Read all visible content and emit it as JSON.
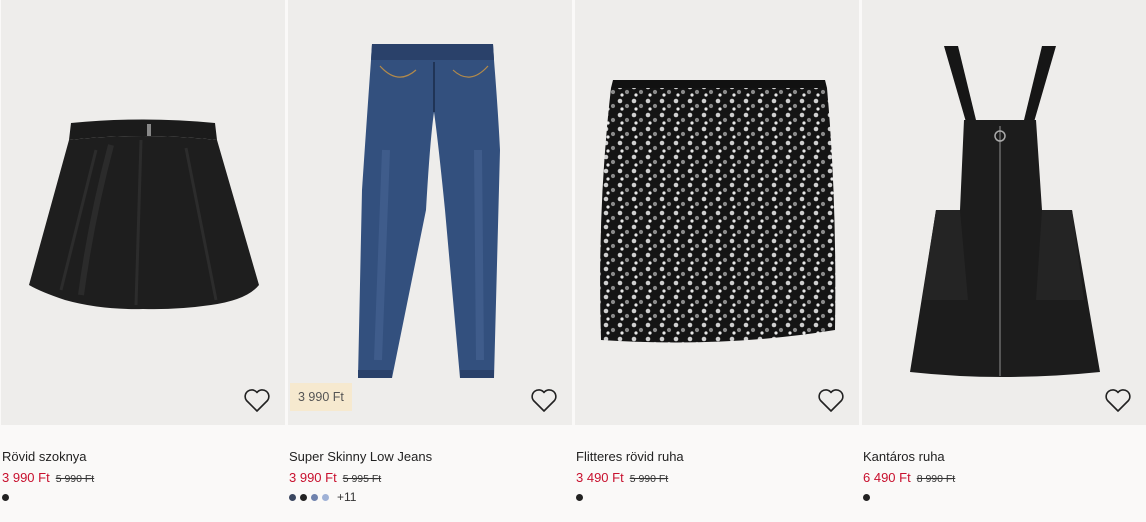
{
  "products": [
    {
      "name": "Rövid szoknya",
      "price": "3 990 Ft",
      "old_price": "5 990 Ft",
      "tag": "",
      "swatch_colors": [
        "#222222"
      ],
      "more_colors": ""
    },
    {
      "name": "Super Skinny Low Jeans",
      "price": "3 990 Ft",
      "old_price": "5 995 Ft",
      "tag": "3 990 Ft",
      "swatch_colors": [
        "#3a4660",
        "#222222",
        "#6f82ad",
        "#9fb1d6"
      ],
      "more_colors": "+11"
    },
    {
      "name": "Flitteres rövid ruha",
      "price": "3 490 Ft",
      "old_price": "5 990 Ft",
      "tag": "",
      "swatch_colors": [
        "#222222"
      ],
      "more_colors": ""
    },
    {
      "name": "Kantáros ruha",
      "price": "6 490 Ft",
      "old_price": "8 990 Ft",
      "tag": "",
      "swatch_colors": [
        "#222222"
      ],
      "more_colors": ""
    }
  ],
  "icons": {
    "favorite": "heart-outline-icon"
  },
  "colors": {
    "sale_price": "#c8102e",
    "tag_bg": "#f6e9cf",
    "image_bg": "#eeedeb"
  }
}
